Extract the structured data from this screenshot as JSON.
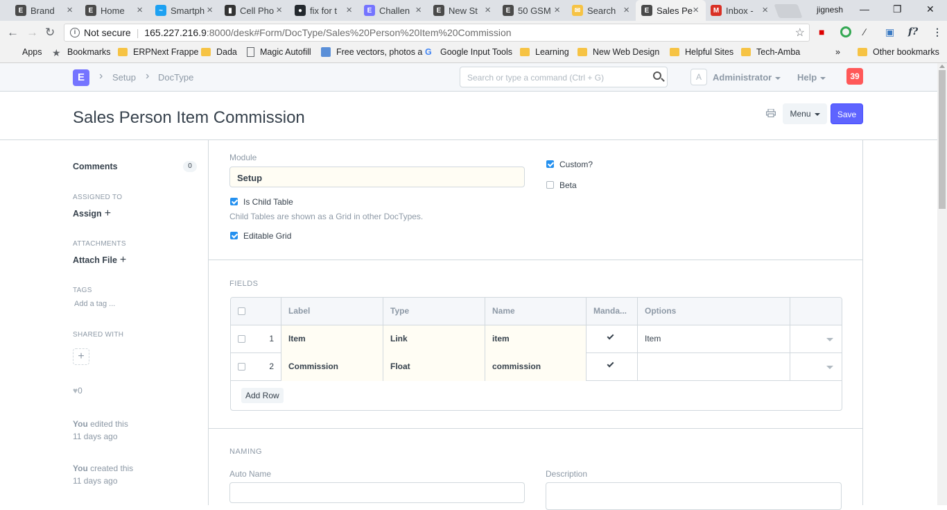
{
  "browser": {
    "tabs": [
      {
        "title": "Brand",
        "favicon": "E",
        "color": "#4a4a4a"
      },
      {
        "title": "Home",
        "favicon": "E",
        "color": "#4a4a4a"
      },
      {
        "title": "Smartph",
        "favicon": "~",
        "color": "#1da1f2"
      },
      {
        "title": "Cell Pho",
        "favicon": "▮",
        "color": "#333333"
      },
      {
        "title": "fix for t",
        "favicon": "●",
        "color": "#24292e"
      },
      {
        "title": "Challen",
        "favicon": "E",
        "color": "#7574ff"
      },
      {
        "title": "New St",
        "favicon": "E",
        "color": "#4a4a4a"
      },
      {
        "title": "50 GSM",
        "favicon": "E",
        "color": "#4a4a4a"
      },
      {
        "title": "Search",
        "favicon": "✉",
        "color": "#f6c344"
      },
      {
        "title": "Sales Pe",
        "favicon": "E",
        "color": "#4a4a4a",
        "active": true
      },
      {
        "title": "Inbox -",
        "favicon": "M",
        "color": "#d93025"
      }
    ],
    "profile": "jignesh",
    "url_security": "Not secure",
    "url_host": "165.227.216.9",
    "url_path": ":8000/desk#Form/DocType/Sales%20Person%20Item%20Commission",
    "bookmarks": [
      {
        "label": "Apps",
        "icon": "apps-grid-icon"
      },
      {
        "label": "Bookmarks",
        "icon": "star-icon"
      },
      {
        "label": "ERPNext Frappe",
        "icon": "folder-icon"
      },
      {
        "label": "Dada",
        "icon": "folder-icon"
      },
      {
        "label": "Magic Autofill",
        "icon": "page-icon"
      },
      {
        "label": "Free vectors, photos a",
        "icon": "image-icon"
      },
      {
        "label": "Google Input Tools",
        "icon": "google-icon"
      },
      {
        "label": "Learning",
        "icon": "folder-icon"
      },
      {
        "label": "New  Web Design",
        "icon": "folder-icon"
      },
      {
        "label": "Helpful Sites",
        "icon": "folder-icon"
      },
      {
        "label": "Tech-Amba",
        "icon": "folder-icon"
      }
    ],
    "overflow": "»",
    "other_bookmarks": "Other bookmarks"
  },
  "app": {
    "logo": "E",
    "breadcrumbs": [
      "Setup",
      "DocType"
    ],
    "search_placeholder": "Search or type a command (Ctrl + G)",
    "avatar": "A",
    "user": "Administrator",
    "help": "Help",
    "notifications": "39",
    "accent": "#5e64ff"
  },
  "page": {
    "title": "Sales Person Item Commission",
    "menu_label": "Menu",
    "save_label": "Save"
  },
  "sidebar": {
    "comments_label": "Comments",
    "comments_count": "0",
    "assigned_to": "ASSIGNED TO",
    "assign": "Assign",
    "attachments": "ATTACHMENTS",
    "attach_file": "Attach File",
    "tags": "TAGS",
    "add_tag": "Add a tag ...",
    "shared_with": "SHARED WITH",
    "likes": "0",
    "edited_by": "You",
    "edited_text": "edited this",
    "edited_when": "11 days ago",
    "created_by": "You",
    "created_text": "created this",
    "created_when": "11 days ago"
  },
  "form": {
    "module_label": "Module",
    "module_value": "Setup",
    "is_child_table": "Is Child Table",
    "is_child_table_checked": true,
    "child_help": "Child Tables are shown as a Grid in other DocTypes.",
    "editable_grid": "Editable Grid",
    "editable_grid_checked": true,
    "custom": "Custom?",
    "custom_checked": true,
    "beta": "Beta",
    "beta_checked": false
  },
  "fields_section": {
    "title": "FIELDS",
    "columns": [
      "Label",
      "Type",
      "Name",
      "Manda...",
      "Options"
    ],
    "rows": [
      {
        "idx": "1",
        "label": "Item",
        "type": "Link",
        "name": "item",
        "mandatory": true,
        "options": "Item"
      },
      {
        "idx": "2",
        "label": "Commission",
        "type": "Float",
        "name": "commission",
        "mandatory": true,
        "options": ""
      }
    ],
    "add_row": "Add Row"
  },
  "naming_section": {
    "title": "NAMING",
    "auto_name_label": "Auto Name",
    "description_label": "Description"
  }
}
